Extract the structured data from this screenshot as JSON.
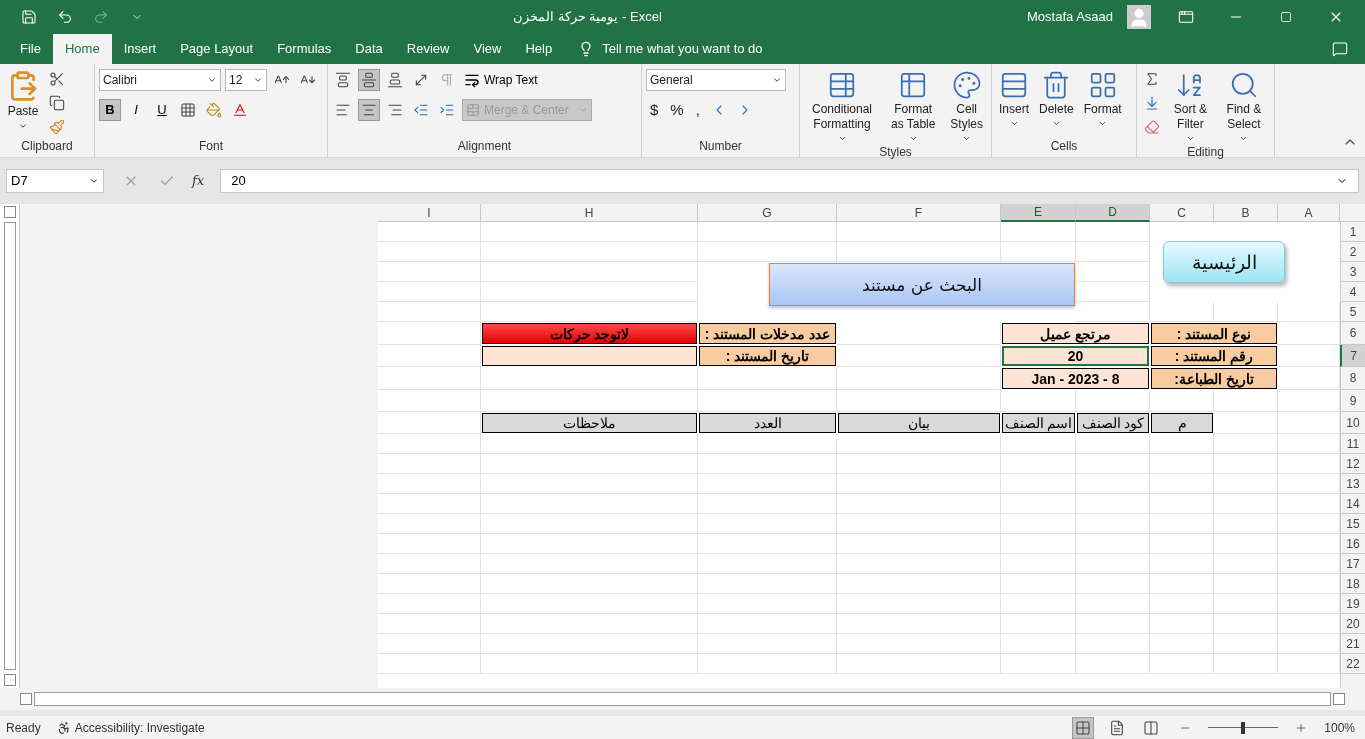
{
  "window": {
    "title": "يومية حركة المخزن  -  Excel",
    "user": "Mostafa Asaad"
  },
  "tabs": [
    {
      "label": "File",
      "selected": false
    },
    {
      "label": "Home",
      "selected": true
    },
    {
      "label": "Insert",
      "selected": false
    },
    {
      "label": "Page Layout",
      "selected": false
    },
    {
      "label": "Formulas",
      "selected": false
    },
    {
      "label": "Data",
      "selected": false
    },
    {
      "label": "Review",
      "selected": false
    },
    {
      "label": "View",
      "selected": false
    },
    {
      "label": "Help",
      "selected": false
    }
  ],
  "tell_me": "Tell me what you want to do",
  "ribbon": {
    "groups": [
      {
        "kind": "clipboard",
        "label": "Clipboard",
        "paste": "Paste"
      },
      {
        "kind": "font",
        "label": "Font",
        "font": "Calibri",
        "size": "12",
        "buttons": [
          {
            "label": "B",
            "on": true
          },
          {
            "label": "I",
            "on": false
          },
          {
            "label": "U",
            "on": false
          }
        ]
      },
      {
        "kind": "alignment",
        "label": "Alignment",
        "wrap": "Wrap Text",
        "merge": {
          "label": "Merge & Center",
          "disabled": true
        },
        "vertical": [
          {
            "selected": false
          },
          {
            "selected": true
          },
          {
            "selected": false
          }
        ],
        "horizontal": [
          {
            "selected": false
          },
          {
            "selected": true
          },
          {
            "selected": false
          }
        ]
      },
      {
        "kind": "number",
        "label": "Number",
        "format": "General",
        "symbols": [
          "$",
          "%",
          ","
        ]
      },
      {
        "kind": "styles",
        "label": "Styles",
        "buttons": [
          "Conditional Formatting",
          "Format as Table",
          "Cell Styles"
        ]
      },
      {
        "kind": "cells",
        "label": "Cells",
        "buttons": [
          "Insert",
          "Delete",
          "Format"
        ]
      },
      {
        "kind": "editing",
        "label": "Editing",
        "buttons": [
          "Sort & Filter",
          "Find & Select"
        ]
      }
    ]
  },
  "formula_bar": {
    "name_box": "D7",
    "function_label": "fx",
    "value": "20"
  },
  "sheet": {
    "columns": [
      {
        "label": "I",
        "selected": false
      },
      {
        "label": "H",
        "selected": false
      },
      {
        "label": "G",
        "selected": false
      },
      {
        "label": "F",
        "selected": false
      },
      {
        "label": "E",
        "selected": true
      },
      {
        "label": "D",
        "selected": true
      },
      {
        "label": "C",
        "selected": false
      },
      {
        "label": "B",
        "selected": false
      },
      {
        "label": "A",
        "selected": false
      }
    ],
    "rows": [
      {
        "label": "1",
        "selected": false
      },
      {
        "label": "2",
        "selected": false
      },
      {
        "label": "3",
        "selected": false
      },
      {
        "label": "4",
        "selected": false
      },
      {
        "label": "5",
        "selected": false
      },
      {
        "label": "6",
        "selected": false
      },
      {
        "label": "7",
        "selected": true
      },
      {
        "label": "8",
        "selected": false
      },
      {
        "label": "9",
        "selected": false
      },
      {
        "label": "10",
        "selected": false
      },
      {
        "label": "11",
        "selected": false
      },
      {
        "label": "12",
        "selected": false
      },
      {
        "label": "13",
        "selected": false
      },
      {
        "label": "14",
        "selected": false
      },
      {
        "label": "15",
        "selected": false
      },
      {
        "label": "16",
        "selected": false
      },
      {
        "label": "17",
        "selected": false
      },
      {
        "label": "18",
        "selected": false
      },
      {
        "label": "19",
        "selected": false
      },
      {
        "label": "20",
        "selected": false
      },
      {
        "label": "21",
        "selected": false
      },
      {
        "label": "22",
        "selected": false
      }
    ],
    "home_button": "الرئيسية",
    "search_button": "البحث عن مستند",
    "info_left": [
      {
        "label": "عدد مدخلات المستند :",
        "value": "لاتوجد حركات",
        "alert": true
      },
      {
        "label": "تاريخ المستند :",
        "alert": false
      }
    ],
    "info_right": [
      {
        "label": "نوع المستند :",
        "value": "مرتجع عميل",
        "active": false
      },
      {
        "label": "رقم المستند :",
        "value": "20",
        "active": true
      },
      {
        "label": "تاريخ الطباعة:",
        "value": "8 - Jan - 2023",
        "active": false
      }
    ],
    "table_columns": [
      "م",
      "كود الصنف",
      "اسم الصنف",
      "بيان",
      "العدد",
      "ملاحظات"
    ]
  },
  "status": {
    "ready": "Ready",
    "accessibility": "Accessibility: Investigate",
    "zoom": {
      "label": "100%",
      "level": 0.5
    }
  }
}
